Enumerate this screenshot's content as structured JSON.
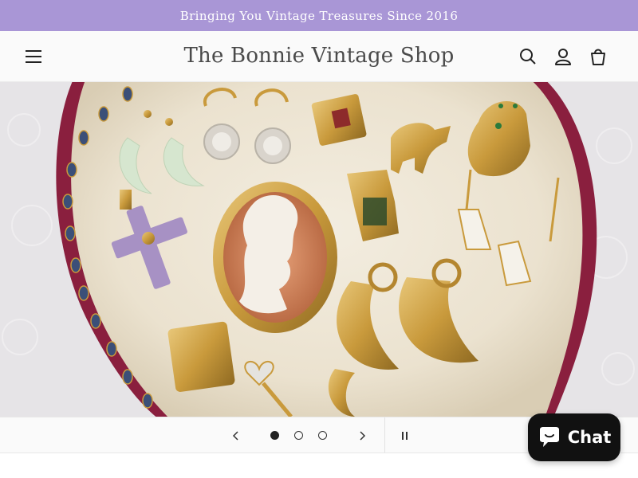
{
  "announcement": {
    "text": "Bringing You Vintage Treasures Since 2016"
  },
  "header": {
    "logo_text": "The Bonnie Vintage Shop",
    "icons": [
      "menu-icon",
      "search-icon",
      "account-icon",
      "cart-icon"
    ]
  },
  "hero": {
    "slide_count": 3,
    "active_slide": 1,
    "description_icons": [
      "cameo-brooch",
      "hoop-earrings",
      "cross-pendant",
      "horse-charm",
      "cat-pendant",
      "lantern-charm"
    ]
  },
  "slider": {
    "controls": [
      "chevron-left-icon",
      "chevron-right-icon",
      "pause-icon"
    ]
  },
  "chat": {
    "label": "Chat"
  },
  "colors": {
    "announcement_bg": "#a996d6",
    "header_bg": "#fafafa",
    "chat_bg": "#111111",
    "gold": "#c99a3c"
  }
}
